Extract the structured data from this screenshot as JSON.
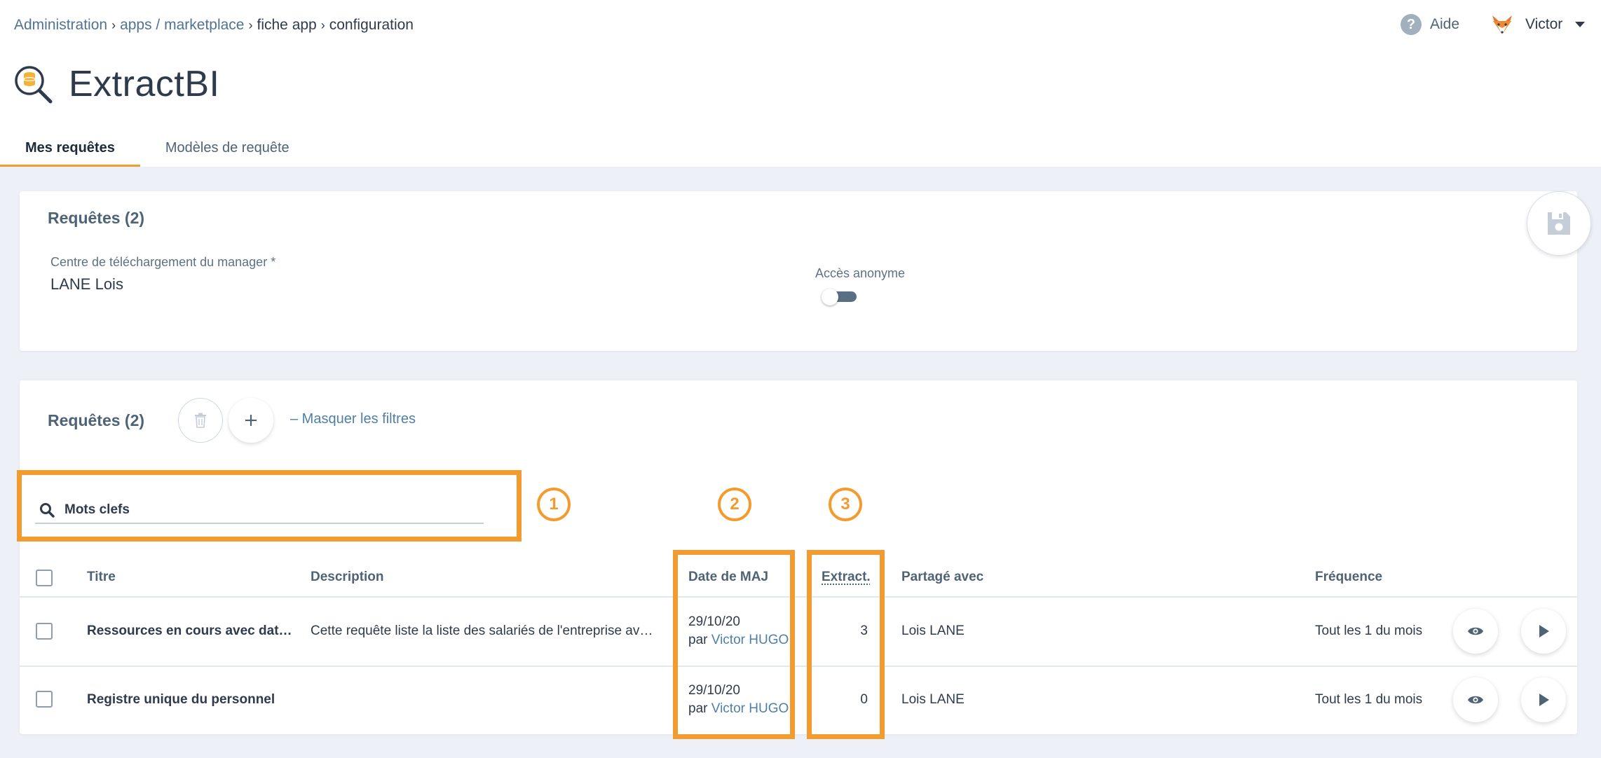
{
  "breadcrumb": {
    "items": [
      "Administration",
      "apps / marketplace",
      "fiche app",
      "configuration"
    ]
  },
  "header": {
    "help_label": "Aide",
    "user_name": "Victor"
  },
  "app": {
    "title": "ExtractBI",
    "tabs": [
      {
        "label": "Mes requêtes",
        "active": true
      },
      {
        "label": "Modèles de requête",
        "active": false
      }
    ]
  },
  "settings_card": {
    "title": "Requêtes (2)",
    "manager_label": "Centre de téléchargement du manager *",
    "manager_value": "LANE Lois",
    "anonymous_label": "Accès anonyme",
    "anonymous_enabled": false
  },
  "queries": {
    "title": "Requêtes (2)",
    "toggle_filters": "– Masquer les filtres",
    "search_placeholder": "Mots clefs",
    "badges": [
      "1",
      "2",
      "3"
    ],
    "columns": {
      "title": "Titre",
      "description": "Description",
      "date": "Date de MAJ",
      "extract": "Extract.",
      "shared": "Partagé avec",
      "frequency": "Fréquence"
    },
    "rows": [
      {
        "title": "Ressources en cours avec dat…",
        "description": "Cette requête liste la liste des salariés de l'entreprise av…",
        "date": "29/10/20",
        "by": "par",
        "author": "Victor HUGO",
        "extract": "3",
        "shared": "Lois LANE",
        "frequency": "Tout les 1 du mois"
      },
      {
        "title": "Registre unique du personnel",
        "description": "",
        "date": "29/10/20",
        "by": "par",
        "author": "Victor HUGO",
        "extract": "0",
        "shared": "Lois LANE",
        "frequency": "Tout les 1 du mois"
      }
    ]
  },
  "colors": {
    "accent": "#f39b2f",
    "link": "#4f7fa6",
    "text": "#2f3b4c",
    "background": "#edf1f7"
  }
}
